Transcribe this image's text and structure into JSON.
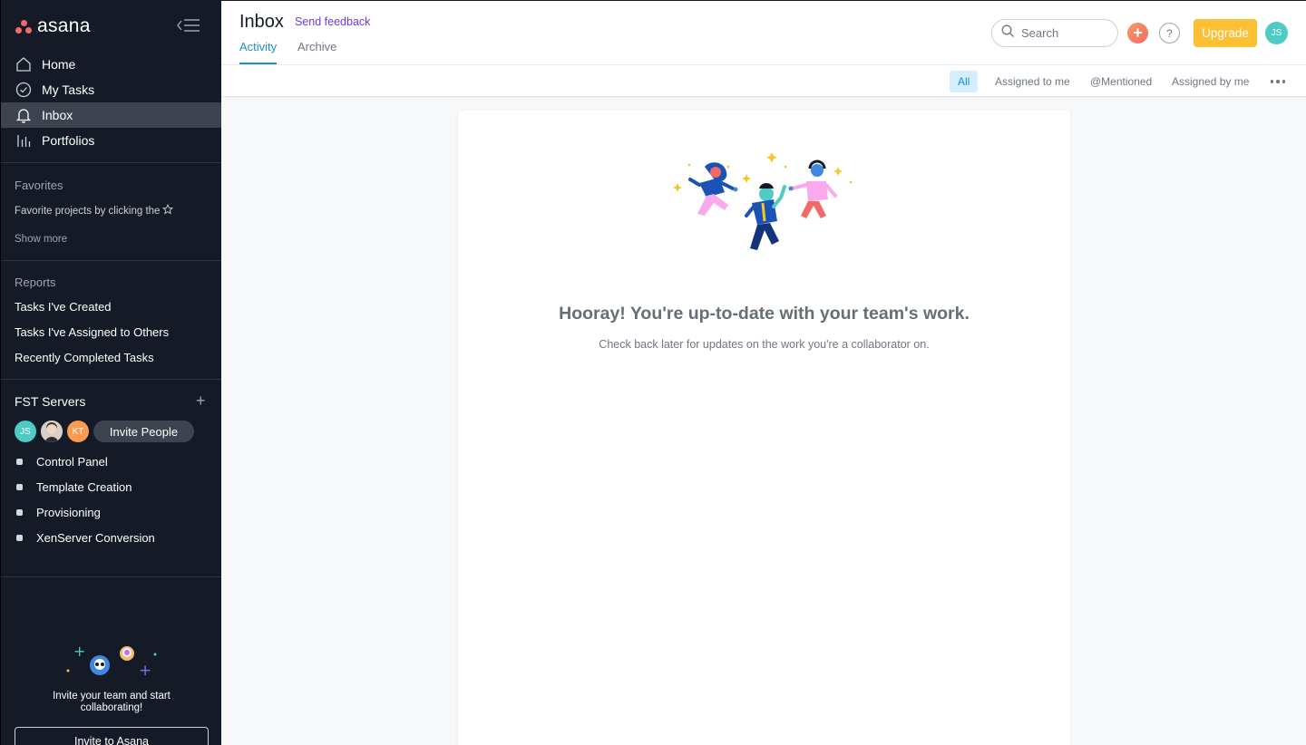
{
  "sidebar": {
    "logo_text": "asana",
    "nav": [
      {
        "label": "Home",
        "icon": "home-icon"
      },
      {
        "label": "My Tasks",
        "icon": "check-circle-icon"
      },
      {
        "label": "Inbox",
        "icon": "bell-icon",
        "active": true
      },
      {
        "label": "Portfolios",
        "icon": "bar-chart-icon"
      }
    ],
    "favorites": {
      "title": "Favorites",
      "hint": "Favorite projects by clicking the",
      "hint_icon": "star-outline-icon",
      "show_more": "Show more"
    },
    "reports": {
      "title": "Reports",
      "items": [
        "Tasks I've Created",
        "Tasks I've Assigned to Others",
        "Recently Completed Tasks"
      ]
    },
    "team": {
      "name": "FST Servers",
      "members": [
        {
          "initials": "JS",
          "color": "#4ecbc4"
        },
        {
          "initials": "",
          "color": "#e8ecee"
        },
        {
          "initials": "KT",
          "color": "#fd9a51"
        }
      ],
      "invite_label": "Invite People",
      "projects": [
        "Control Panel",
        "Template Creation",
        "Provisioning",
        "XenServer Conversion"
      ]
    },
    "invite_promo": {
      "text": "Invite your team and start collaborating!",
      "button": "Invite to Asana"
    }
  },
  "header": {
    "title": "Inbox",
    "feedback": "Send feedback",
    "tabs": [
      {
        "label": "Activity",
        "active": true
      },
      {
        "label": "Archive",
        "active": false
      }
    ],
    "search_placeholder": "Search",
    "help_label": "?",
    "upgrade_label": "Upgrade",
    "user_initials": "JS"
  },
  "filters": {
    "items": [
      {
        "label": "All",
        "active": true
      },
      {
        "label": "Assigned to me",
        "active": false
      },
      {
        "label": "@Mentioned",
        "active": false
      },
      {
        "label": "Assigned by me",
        "active": false
      }
    ]
  },
  "empty_state": {
    "title": "Hooray! You're up-to-date with your team's work.",
    "subtitle": "Check back later for updates on the work you're a collaborator on."
  },
  "colors": {
    "sidebar_bg": "#151b26",
    "accent_blue": "#1f8dd6",
    "upgrade": "#fdbf33",
    "brand_coral": "#f06a6a",
    "feedback_purple": "#6a3ce0"
  }
}
